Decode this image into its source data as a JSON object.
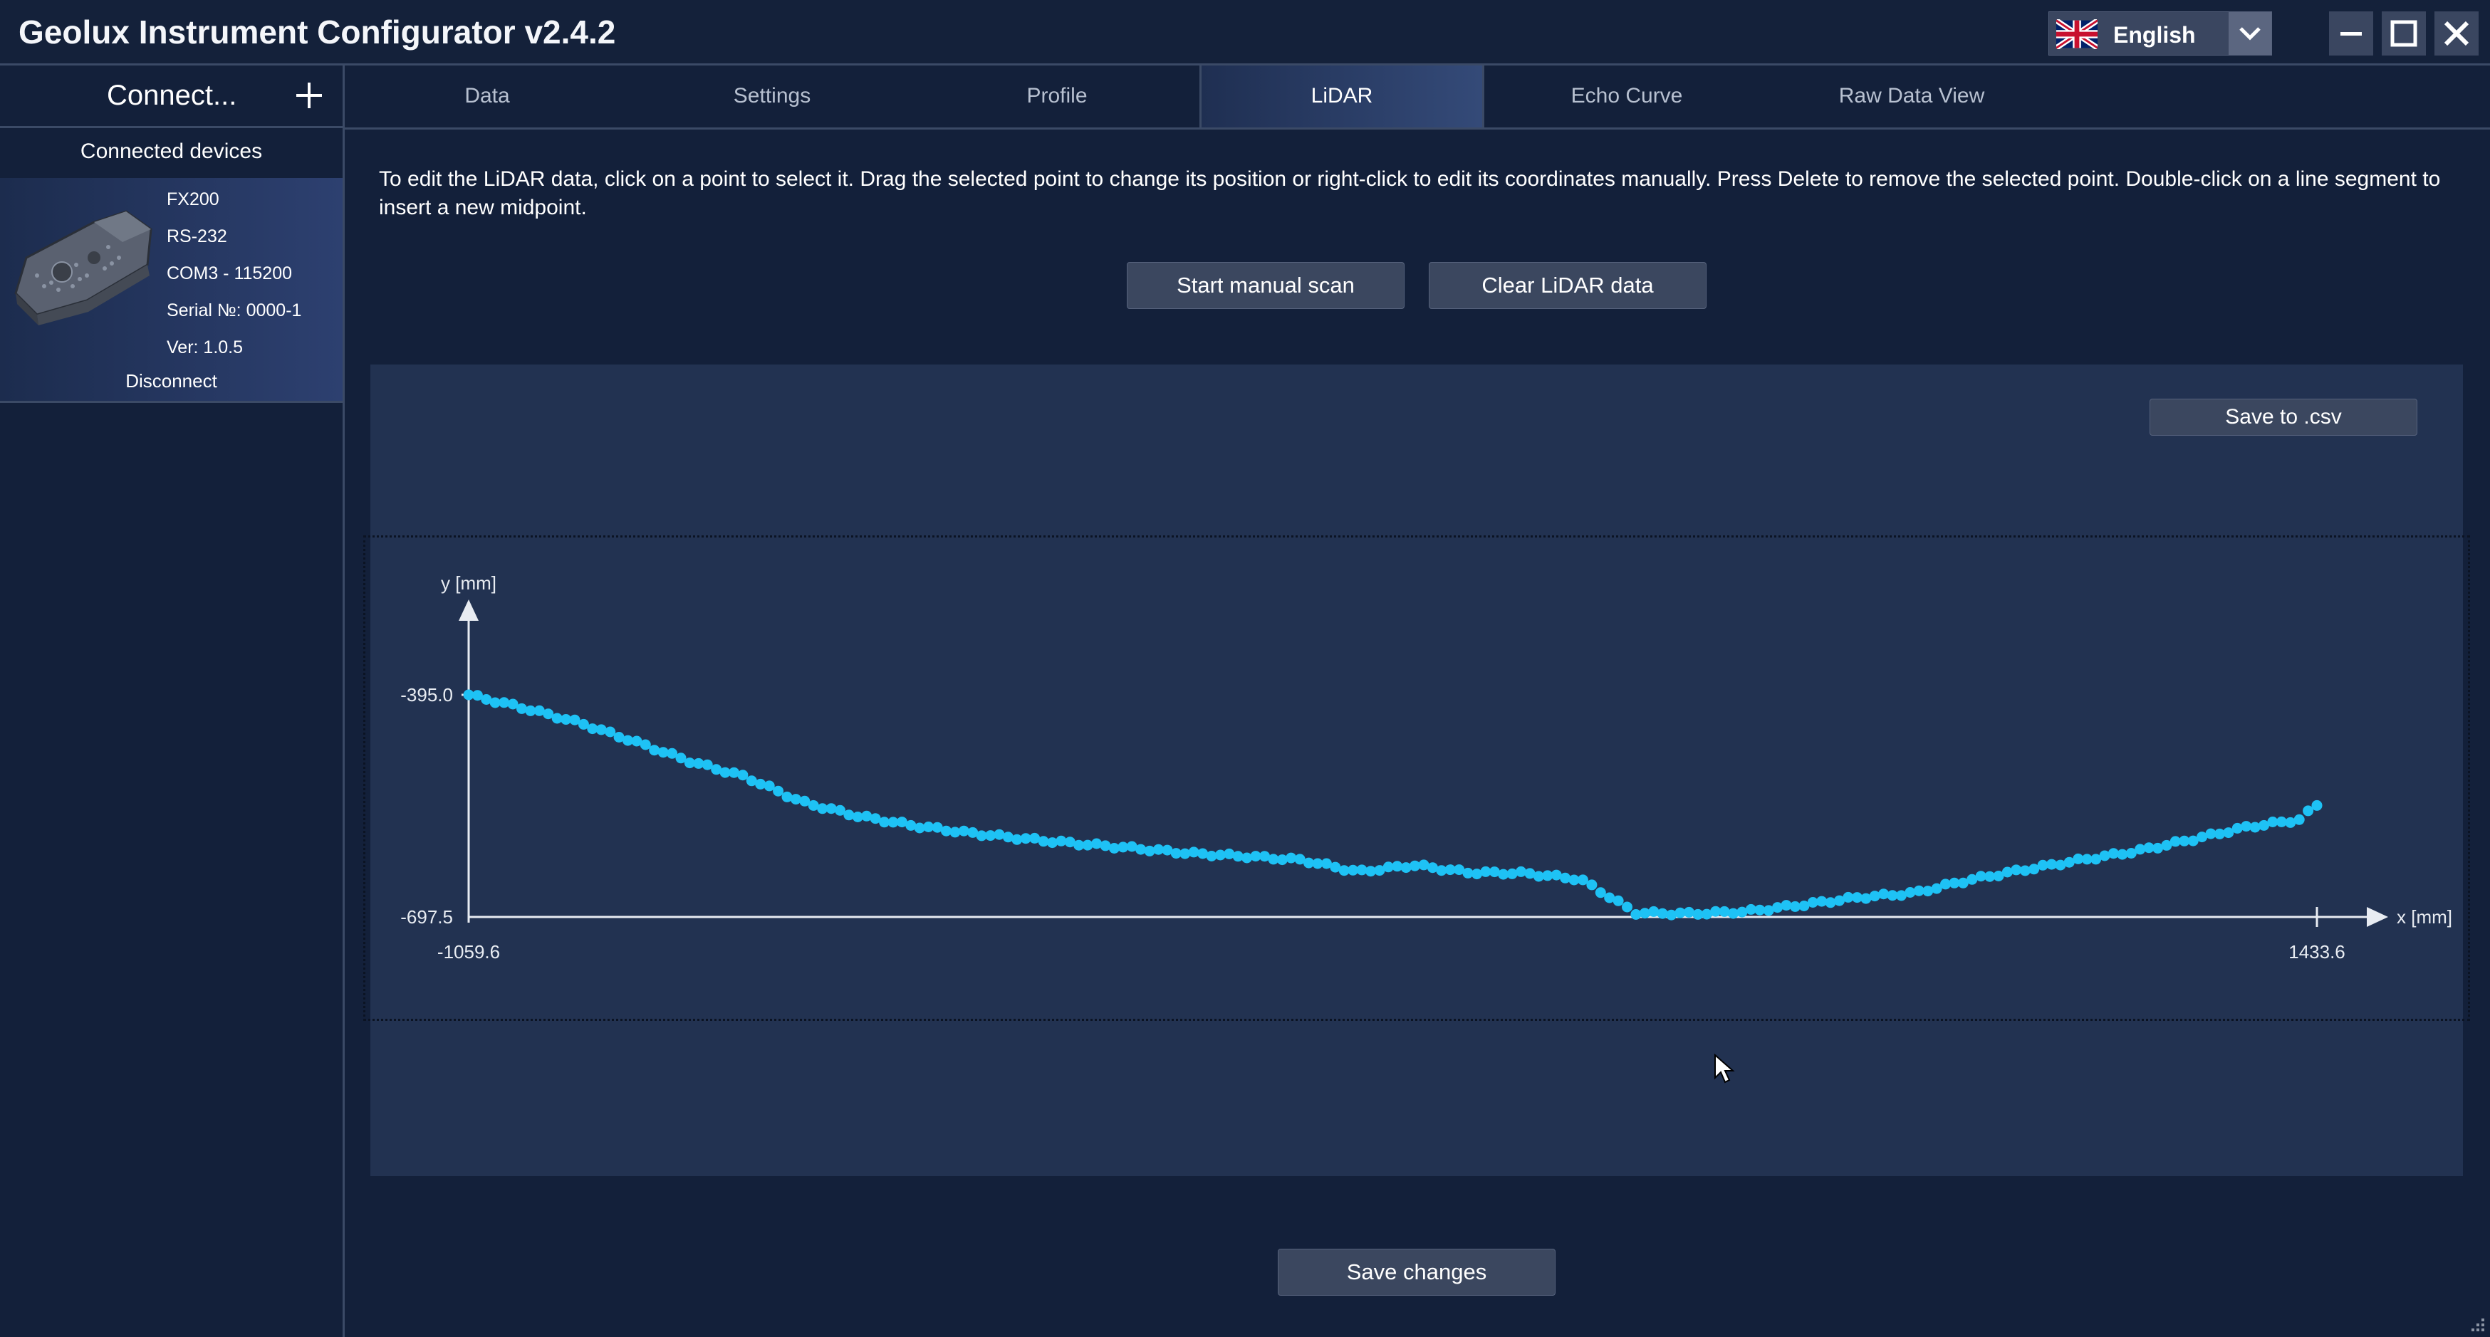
{
  "window": {
    "title": "Geolux Instrument Configurator v2.4.2",
    "language": "English"
  },
  "sidebar": {
    "connect_label": "Connect...",
    "devices_title": "Connected devices",
    "device": {
      "model": "FX200",
      "interface": "RS-232",
      "port": "COM3 - 115200",
      "serial": "Serial №: 0000-1",
      "version": "Ver:  1.0.5",
      "disconnect_label": "Disconnect"
    }
  },
  "tabs": [
    {
      "label": "Data",
      "active": false
    },
    {
      "label": "Settings",
      "active": false
    },
    {
      "label": "Profile",
      "active": false
    },
    {
      "label": "LiDAR",
      "active": true
    },
    {
      "label": "Echo Curve",
      "active": false
    },
    {
      "label": "Raw Data View",
      "active": false
    }
  ],
  "main": {
    "instructions": "To edit the LiDAR data, click on a point to select it. Drag the selected point to change its position or right-click to edit its coordinates manually. Press Delete to remove the selected point. Double-click on a line segment to insert a new midpoint.",
    "start_scan_label": "Start manual scan",
    "clear_label": "Clear LiDAR data",
    "save_csv_label": "Save to .csv",
    "save_changes_label": "Save changes"
  },
  "colors": {
    "background": "#13203a",
    "panel": "#223251",
    "point": "#1ec2f5",
    "button": "#3b475f"
  },
  "chart_data": {
    "type": "scatter",
    "xlabel": "x [mm]",
    "ylabel": "y [mm]",
    "x_ticks": [
      "-1059.6",
      "1433.6"
    ],
    "y_ticks": [
      "-395.0",
      "-697.5"
    ],
    "xlim": [
      -1059.6,
      1433.6
    ],
    "ylim": [
      -697.5,
      -395.0
    ],
    "grid": false,
    "series": [
      {
        "x": [
          -1059.6,
          -985.0,
          -910.0,
          -835.0,
          -760.0,
          -685.0,
          -610.0,
          -535.0,
          -460.0,
          -385.0,
          -310.0,
          -235.0,
          -160.0,
          -85.0,
          -10.0,
          65.0,
          140.0,
          215.0,
          290.0,
          365.0,
          440.0,
          515.0,
          590.0,
          665.0,
          740.0,
          815.0,
          890.0,
          965.0,
          1040.0,
          1115.0,
          1190.0,
          1265.0,
          1340.0,
          1410.0,
          1433.6
        ],
        "y": [
          -395.0,
          -413.0,
          -433.0,
          -459.0,
          -486.0,
          -507.0,
          -541.0,
          -560.0,
          -573.0,
          -583.0,
          -591.0,
          -598.0,
          -604.0,
          -611.0,
          -615.0,
          -620.0,
          -636.0,
          -627.0,
          -637.0,
          -638.0,
          -646.0,
          -692.0,
          -693.0,
          -690.0,
          -681.0,
          -671.0,
          -665.0,
          -647.0,
          -633.0,
          -620.0,
          -608.0,
          -592.0,
          -575.0,
          -565.0,
          -545.0
        ]
      }
    ]
  }
}
